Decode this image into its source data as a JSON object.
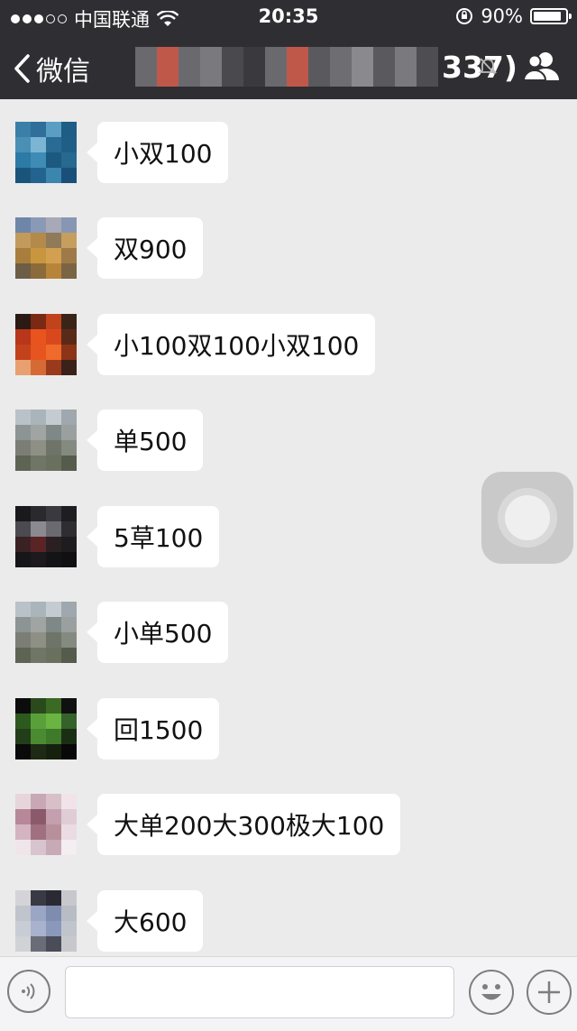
{
  "status_bar": {
    "carrier": "中国联通",
    "time": "20:35",
    "battery_percent": "90%",
    "battery_level": 0.9
  },
  "nav": {
    "back_label": "微信",
    "title_suffix": "337)",
    "title_obscured": true
  },
  "messages": [
    {
      "text": "小双100",
      "avatar_colors": [
        "#3a7fa8",
        "#2f6f9a",
        "#5a9ec4",
        "#1e5d86",
        "#4a8fb6",
        "#7bb5d3",
        "#2a6b94",
        "#1f5f87",
        "#2c7aa6",
        "#3e8cb5",
        "#1d5880",
        "#27698f",
        "#1b547a",
        "#236390",
        "#3a86ae",
        "#195079"
      ]
    },
    {
      "text": "双900",
      "avatar_colors": [
        "#6e86a8",
        "#8a9ab6",
        "#a7a9b6",
        "#8797b3",
        "#c19a5c",
        "#b38a4a",
        "#8f7a5a",
        "#c69e5e",
        "#a97e3c",
        "#c8963e",
        "#d2a050",
        "#9e7a48",
        "#6c5e46",
        "#8c6b3a",
        "#b8843a",
        "#7a6444"
      ]
    },
    {
      "text": "小100双100小双100",
      "avatar_colors": [
        "#2b1a14",
        "#7a2a14",
        "#c0431c",
        "#3a2418",
        "#b8361a",
        "#e8531e",
        "#d9481c",
        "#5a2a18",
        "#c2421c",
        "#e65420",
        "#f06a2c",
        "#8c3418",
        "#e8a070",
        "#d66a34",
        "#9a3a1c",
        "#3a2218"
      ]
    },
    {
      "text": "单500",
      "avatar_colors": [
        "#b9c2c8",
        "#aab4bb",
        "#c4ccd1",
        "#9ea8ae",
        "#8c9494",
        "#a0a4a2",
        "#7e8886",
        "#9aa0a0",
        "#7a7e74",
        "#8e9086",
        "#6e7468",
        "#848a80",
        "#5e6454",
        "#707666",
        "#6a705e",
        "#565c4c"
      ]
    },
    {
      "text": "5草100",
      "avatar_colors": [
        "#1a1a1c",
        "#2a2a2e",
        "#3a3a3e",
        "#1e1e22",
        "#4a4a50",
        "#8a8a90",
        "#6a6a70",
        "#2e2e32",
        "#3a2224",
        "#5a2426",
        "#2a2022",
        "#1e1c1e",
        "#161618",
        "#1c1a1c",
        "#141416",
        "#101012"
      ]
    },
    {
      "text": "小单500",
      "avatar_colors": [
        "#b9c2c8",
        "#aab4bb",
        "#c4ccd1",
        "#9ea8ae",
        "#8c9494",
        "#a0a4a2",
        "#7e8886",
        "#9aa0a0",
        "#7a7e74",
        "#8e9086",
        "#6e7468",
        "#848a80",
        "#5e6454",
        "#707666",
        "#6a705e",
        "#565c4c"
      ]
    },
    {
      "text": "回1500",
      "avatar_colors": [
        "#0c0c0c",
        "#2a4a1c",
        "#3a6a24",
        "#101010",
        "#2c5a1e",
        "#5aa03a",
        "#6ab442",
        "#34622a",
        "#223e18",
        "#4a8a30",
        "#3e7a2a",
        "#1a2e14",
        "#0a0a0a",
        "#1e2a14",
        "#16200e",
        "#080808"
      ]
    },
    {
      "text": "大单200大300极大100",
      "avatar_colors": [
        "#e6d6dc",
        "#c8a8b4",
        "#d8c0c8",
        "#f0e4e8",
        "#b88898",
        "#8a5a6a",
        "#c4a0ae",
        "#e0ccd4",
        "#d4b4c0",
        "#a07080",
        "#b8909c",
        "#eadce2",
        "#f0e6ea",
        "#d8c4cc",
        "#c8aab6",
        "#f4eef0"
      ]
    },
    {
      "text": "大600",
      "avatar_colors": [
        "#d4d4d8",
        "#3a3a44",
        "#2a2a34",
        "#c8c8cc",
        "#c0c4cc",
        "#9aa6c4",
        "#7e8cb0",
        "#b8bcc4",
        "#c8ccd4",
        "#a8b2cc",
        "#8a98bc",
        "#c0c4cc",
        "#d0d2d6",
        "#6a6c78",
        "#4a4c58",
        "#c8c8cc"
      ]
    }
  ],
  "title_mosaic_colors": [
    "#6a6a6e",
    "#c0584a",
    "#6a6a6e",
    "#7a7a7e",
    "#4a4a4e",
    "#3a3a3e",
    "#6a6a6e",
    "#c0584a",
    "#5a5a5e",
    "#6e6e72",
    "#8a8a8e",
    "#5a5a5e",
    "#7a7a7e",
    "#4e4e52"
  ],
  "input_bar": {
    "voice_icon": "voice-icon",
    "emoji_icon": "emoji-icon",
    "plus_icon": "plus-icon"
  }
}
